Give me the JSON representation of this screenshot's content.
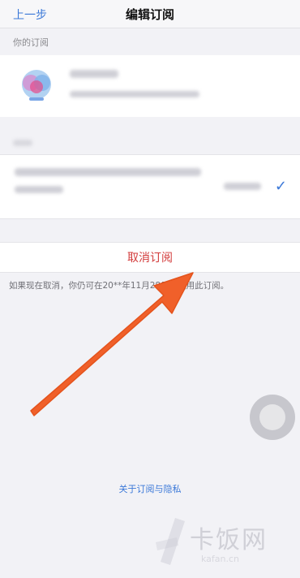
{
  "navbar": {
    "back_label": "上一步",
    "title": "编辑订阅"
  },
  "subscriptions": {
    "section_label": "你的订阅"
  },
  "cancel": {
    "label": "取消订阅"
  },
  "note": {
    "text": "如果现在取消，你仍可在20**年11月28日前使用此订阅。"
  },
  "footer": {
    "link_label": "关于订阅与隐私"
  },
  "watermark": {
    "text": "卡饭网",
    "sub": "kafan.cn"
  },
  "colors": {
    "link": "#3b78d8",
    "destructive": "#d23a3a",
    "arrow": "#f0602a"
  }
}
